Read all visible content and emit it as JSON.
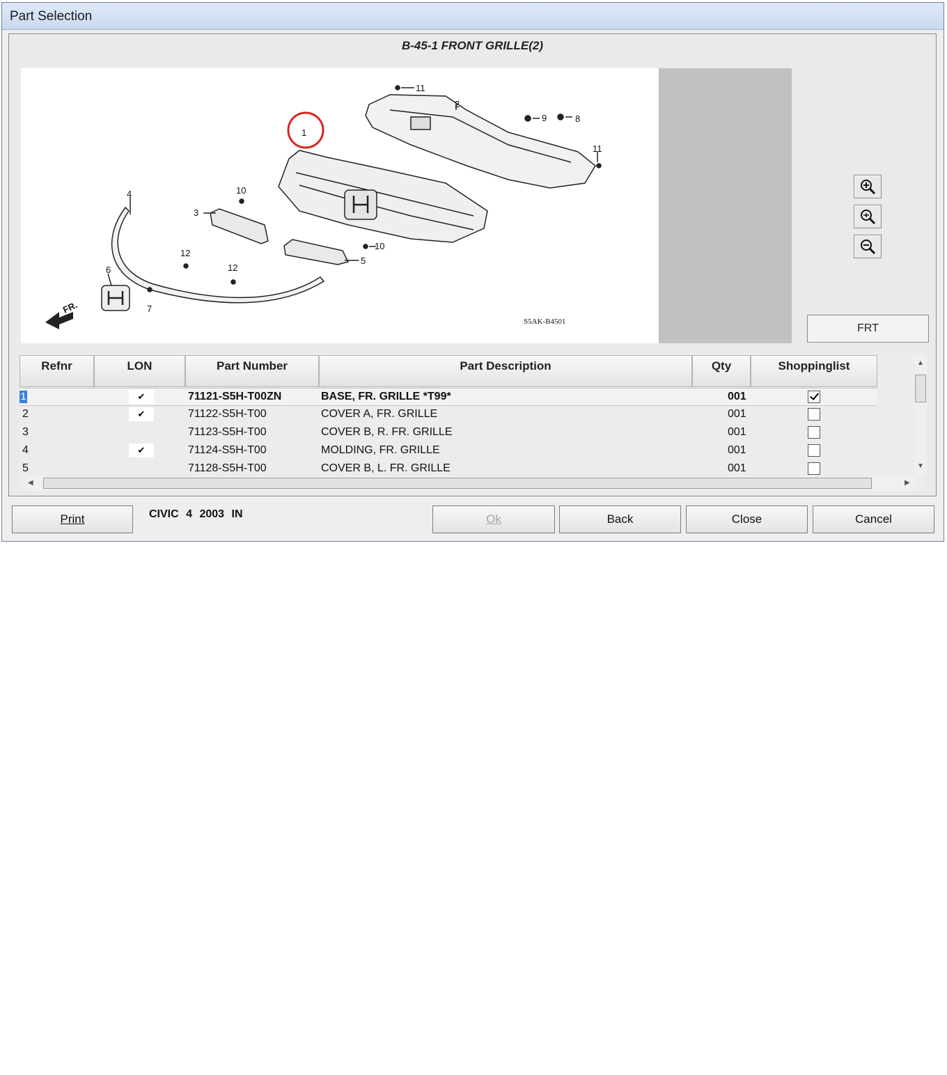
{
  "window": {
    "title": "Part Selection"
  },
  "diagram": {
    "title": "B-45-1 FRONT GRILLE(2)",
    "code": "S5AK-B4501",
    "front_label": "FR.",
    "callouts": [
      "1",
      "2",
      "3",
      "4",
      "5",
      "6",
      "7",
      "8",
      "9",
      "10",
      "10",
      "11",
      "11",
      "12",
      "12"
    ]
  },
  "zoom_buttons": [
    "zoom-in-icon",
    "zoom-fit-icon",
    "zoom-out-icon"
  ],
  "frt_button": "FRT",
  "table": {
    "columns": [
      "Refnr",
      "LON",
      "Part Number",
      "Part Description",
      "Qty",
      "Shoppinglist"
    ],
    "rows": [
      {
        "refnr": "1",
        "lon": "✔",
        "part_number": "71121-S5H-T00ZN",
        "description": "BASE, FR. GRILLE *T99*",
        "qty": "001",
        "shopping": true,
        "selected": true
      },
      {
        "refnr": "2",
        "lon": "✔",
        "part_number": "71122-S5H-T00",
        "description": "COVER A, FR. GRILLE",
        "qty": "001",
        "shopping": false,
        "selected": false
      },
      {
        "refnr": "3",
        "lon": "",
        "part_number": "71123-S5H-T00",
        "description": "COVER B, R. FR. GRILLE",
        "qty": "001",
        "shopping": false,
        "selected": false
      },
      {
        "refnr": "4",
        "lon": "✔",
        "part_number": "71124-S5H-T00",
        "description": "MOLDING, FR. GRILLE",
        "qty": "001",
        "shopping": false,
        "selected": false
      },
      {
        "refnr": "5",
        "lon": "",
        "part_number": "71128-S5H-T00",
        "description": "COVER B, L. FR. GRILLE",
        "qty": "001",
        "shopping": false,
        "selected": false
      }
    ]
  },
  "footer": {
    "print": "Print",
    "model_info": "CIVIC 4 2003 IN",
    "ok": "Ok",
    "back": "Back",
    "close": "Close",
    "cancel": "Cancel"
  }
}
